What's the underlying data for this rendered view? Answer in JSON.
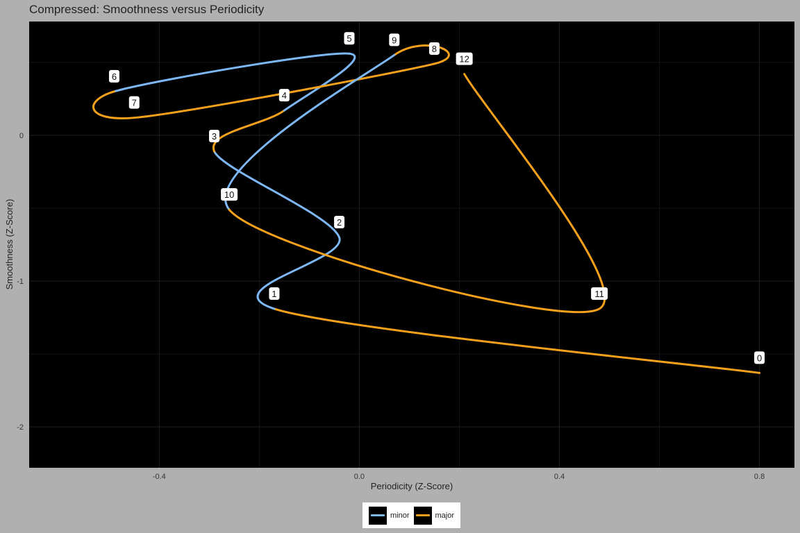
{
  "chart_data": {
    "type": "line",
    "title": "Compressed: Smoothness versus Periodicity",
    "xlabel": "Periodicity (Z-Score)",
    "ylabel": "Smoothness (Z-Score)",
    "xlim": [
      -0.66,
      0.87
    ],
    "ylim": [
      -2.28,
      0.78
    ],
    "xticks": [
      -0.4,
      0.0,
      0.4,
      0.8
    ],
    "xtick_labels": [
      "-0.4",
      "0.0",
      "0.4",
      "0.8"
    ],
    "yticks": [
      -2,
      -1,
      0
    ],
    "ytick_labels": [
      "-2",
      "-1",
      "0"
    ],
    "grid": true,
    "background": "#000000",
    "legend_position": "bottom",
    "series": [
      {
        "name": "major",
        "color": "#f5a11c"
      },
      {
        "name": "minor",
        "color": "#7eb7f5"
      }
    ],
    "points": [
      {
        "label": "0",
        "x": 0.8,
        "y": -1.63
      },
      {
        "label": "1",
        "x": -0.17,
        "y": -1.19
      },
      {
        "label": "2",
        "x": -0.04,
        "y": -0.7
      },
      {
        "label": "3",
        "x": -0.29,
        "y": -0.11
      },
      {
        "label": "4",
        "x": -0.15,
        "y": 0.17
      },
      {
        "label": "5",
        "x": -0.02,
        "y": 0.56
      },
      {
        "label": "6",
        "x": -0.49,
        "y": 0.3
      },
      {
        "label": "7",
        "x": -0.45,
        "y": 0.12
      },
      {
        "label": "8",
        "x": 0.15,
        "y": 0.49
      },
      {
        "label": "9",
        "x": 0.07,
        "y": 0.55
      },
      {
        "label": "10",
        "x": -0.26,
        "y": -0.51
      },
      {
        "label": "11",
        "x": 0.48,
        "y": -1.19
      },
      {
        "label": "12",
        "x": 0.21,
        "y": 0.42
      }
    ],
    "segments": [
      {
        "from": "0",
        "to": "1",
        "series": "major",
        "minor_fraction": 0.52
      },
      {
        "from": "1",
        "to": "2",
        "series": "minor",
        "minor_fraction": 1.0
      },
      {
        "from": "2",
        "to": "3",
        "series": "minor",
        "minor_fraction": 1.0
      },
      {
        "from": "3",
        "to": "4",
        "series": "major",
        "minor_fraction": 0.55
      },
      {
        "from": "4",
        "to": "5",
        "series": "minor",
        "minor_fraction": 1.0
      },
      {
        "from": "5",
        "to": "6",
        "series": "minor",
        "minor_fraction": 1.0
      },
      {
        "from": "6",
        "to": "7",
        "series": "major",
        "minor_fraction": 0.0
      },
      {
        "from": "7",
        "to": "8",
        "series": "major",
        "minor_fraction": 0.0
      },
      {
        "from": "8",
        "to": "9",
        "series": "major",
        "minor_fraction": 0.0
      },
      {
        "from": "9",
        "to": "10",
        "series": "minor",
        "minor_fraction": 1.0
      },
      {
        "from": "10",
        "to": "11",
        "series": "major",
        "minor_fraction": 0.1
      },
      {
        "from": "11",
        "to": "12",
        "series": "major",
        "minor_fraction": 0.0
      }
    ],
    "legend": [
      {
        "name": "minor",
        "color": "#7eb7f5"
      },
      {
        "name": "major",
        "color": "#f5a11c"
      }
    ]
  }
}
